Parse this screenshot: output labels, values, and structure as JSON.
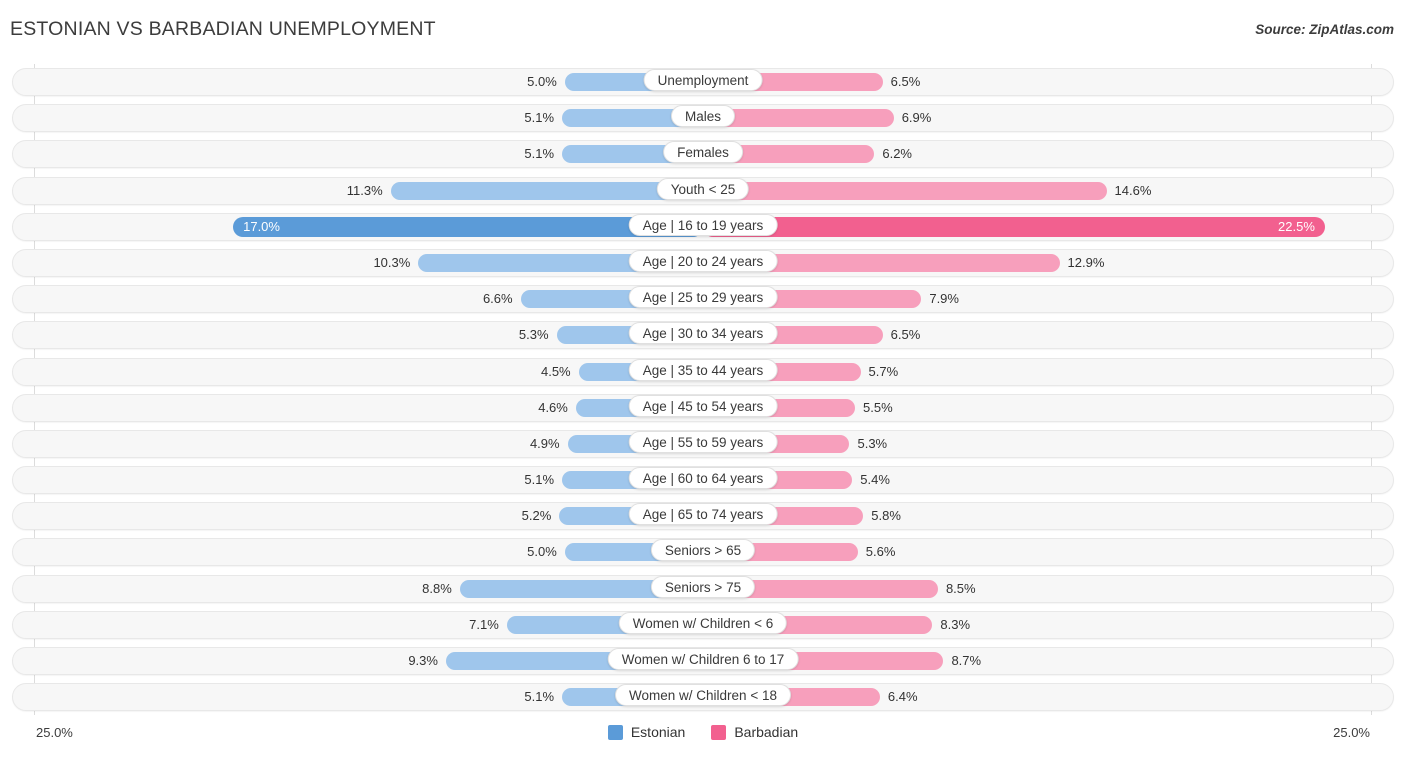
{
  "header": {
    "title": "ESTONIAN VS BARBADIAN UNEMPLOYMENT",
    "source": "Source: ZipAtlas.com"
  },
  "footer": {
    "axis_min_left": "25.0%",
    "axis_min_right": "25.0%"
  },
  "legend": [
    {
      "label": "Estonian",
      "color": "#5B9BD8"
    },
    {
      "label": "Barbadian",
      "color": "#F2608F"
    }
  ],
  "colors": {
    "estonian_light": "#9FC6EC",
    "estonian_dark": "#5B9BD8",
    "barbadian_light": "#F79FBC",
    "barbadian_dark": "#F2608F",
    "track": "#F7F7F7",
    "axis": "#DCDCDC"
  },
  "chart_data": {
    "type": "bar",
    "subtype": "diverging-horizontal",
    "title": "ESTONIAN VS BARBADIAN UNEMPLOYMENT",
    "xlabel": "",
    "ylabel": "",
    "axis_max": 25.0,
    "axis_units": "%",
    "grid": false,
    "legend_position": "bottom-center",
    "categories": [
      "Unemployment",
      "Males",
      "Females",
      "Youth < 25",
      "Age | 16 to 19 years",
      "Age | 20 to 24 years",
      "Age | 25 to 29 years",
      "Age | 30 to 34 years",
      "Age | 35 to 44 years",
      "Age | 45 to 54 years",
      "Age | 55 to 59 years",
      "Age | 60 to 64 years",
      "Age | 65 to 74 years",
      "Seniors > 65",
      "Seniors > 75",
      "Women w/ Children < 6",
      "Women w/ Children 6 to 17",
      "Women w/ Children < 18"
    ],
    "series": [
      {
        "name": "Estonian",
        "color": "#9FC6EC",
        "values": [
          5.0,
          5.1,
          5.1,
          11.3,
          17.0,
          10.3,
          6.6,
          5.3,
          4.5,
          4.6,
          4.9,
          5.1,
          5.2,
          5.0,
          8.8,
          7.1,
          9.3,
          5.1
        ],
        "labels": [
          "5.0%",
          "5.1%",
          "5.1%",
          "11.3%",
          "17.0%",
          "10.3%",
          "6.6%",
          "5.3%",
          "4.5%",
          "4.6%",
          "4.9%",
          "5.1%",
          "5.2%",
          "5.0%",
          "8.8%",
          "7.1%",
          "9.3%",
          "5.1%"
        ]
      },
      {
        "name": "Barbadian",
        "color": "#F79FBC",
        "values": [
          6.5,
          6.9,
          6.2,
          14.6,
          22.5,
          12.9,
          7.9,
          6.5,
          5.7,
          5.5,
          5.3,
          5.4,
          5.8,
          5.6,
          8.5,
          8.3,
          8.7,
          6.4
        ],
        "labels": [
          "6.5%",
          "6.9%",
          "6.2%",
          "14.6%",
          "22.5%",
          "12.9%",
          "7.9%",
          "6.5%",
          "5.7%",
          "5.5%",
          "5.3%",
          "5.4%",
          "5.8%",
          "5.6%",
          "8.5%",
          "8.3%",
          "8.7%",
          "6.4%"
        ]
      }
    ],
    "highlighted_row_index": 4
  }
}
